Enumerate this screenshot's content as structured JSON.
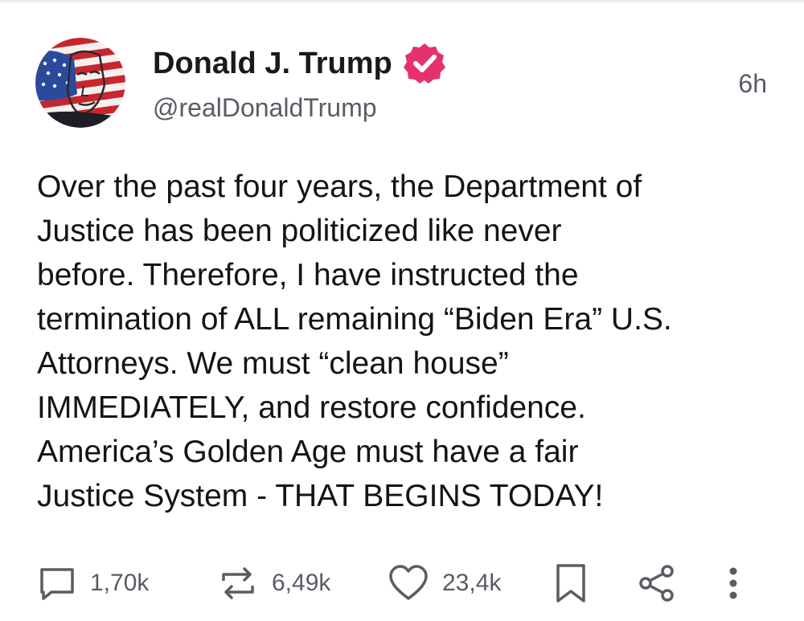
{
  "post": {
    "author": {
      "display_name": "Donald J. Trump",
      "handle": "@realDonaldTrump",
      "verified": true,
      "avatar_icon": "avatar-flag-portrait"
    },
    "timestamp": "6h",
    "text": "Over the past four years, the Department of\nJustice has been politicized like never\nbefore. Therefore, I have instructed the\ntermination of ALL remaining “Biden Era” U.S.\nAttorneys. We must “clean house”\nIMMEDIATELY, and restore confidence.\nAmerica’s Golden Age must have a fair\nJustice System - THAT BEGINS TODAY!",
    "actions": {
      "replies": {
        "icon": "reply-icon",
        "count": "1,70k"
      },
      "reposts": {
        "icon": "repost-icon",
        "count": "6,49k"
      },
      "likes": {
        "icon": "heart-icon",
        "count": "23,4k"
      },
      "bookmark": {
        "icon": "bookmark-icon"
      },
      "share": {
        "icon": "share-icon"
      },
      "more": {
        "icon": "more-icon"
      }
    }
  },
  "colors": {
    "verified_badge": "#e5326f",
    "text_primary": "#141414",
    "text_secondary": "#5b5b66",
    "icon": "#5b5b66"
  }
}
